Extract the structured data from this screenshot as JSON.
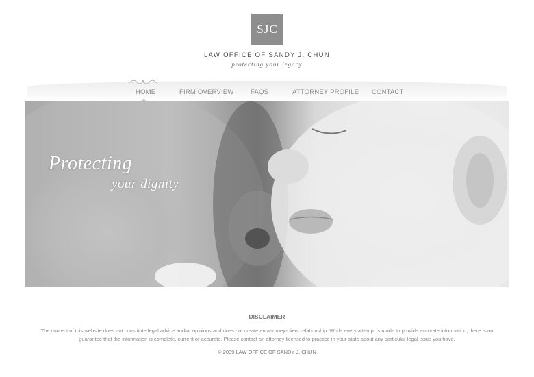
{
  "logo": {
    "monogram": "SJC"
  },
  "header": {
    "firm_name": "LAW OFFICE OF SANDY J. CHUN",
    "tagline": "protecting your legacy"
  },
  "nav": {
    "items": [
      {
        "label": "HOME",
        "active": true
      },
      {
        "label": "FIRM OVERVIEW",
        "active": false
      },
      {
        "label": "FAQS",
        "active": false
      },
      {
        "label": "ATTORNEY PROFILE",
        "active": false
      },
      {
        "label": "CONTACT",
        "active": false
      }
    ]
  },
  "hero": {
    "line1": "Protecting",
    "line2": "your dignity"
  },
  "footer": {
    "disclaimer_title": "DISCLAIMER",
    "disclaimer_text": "The content of this website does not constitute legal advice and/or opinions and does not create an attorney-client relationship. While every attempt is made to provide accurate information, there is no guarantee that the information is complete, current or accurate. Please contact an attorney licensed to practice in your state about any particular legal issue you have.",
    "copyright": "© 2009 LAW OFFICE OF SANDY J. CHUN"
  },
  "colors": {
    "logo_bg": "#8e8e8e",
    "nav_text": "#8a8a8a",
    "text": "#666666"
  }
}
